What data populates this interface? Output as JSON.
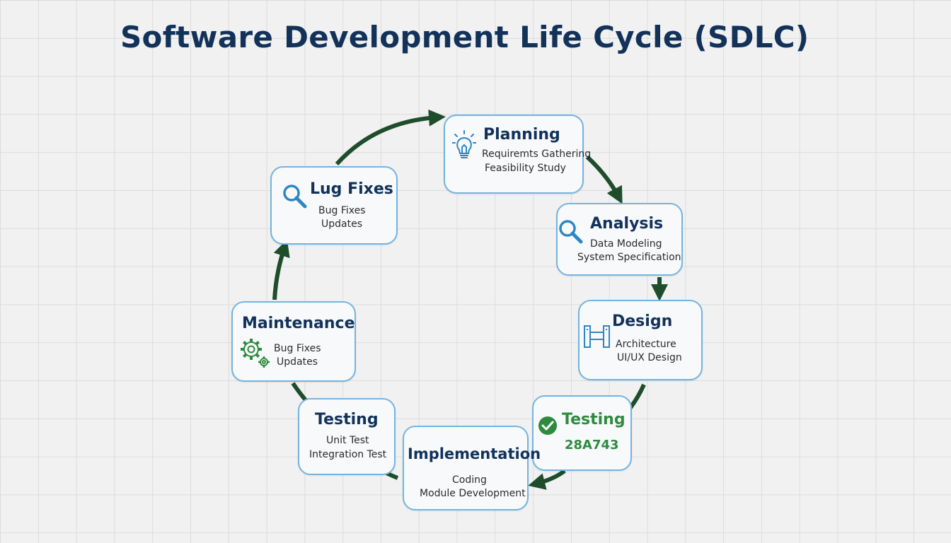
{
  "title": "Software Development Life Cycle (SDLC)",
  "colors": {
    "title": "#12325a",
    "node_border": "#74b4e0",
    "arrow": "#1e4d2b",
    "icon_blue": "#2f86c5",
    "icon_green": "#2e8b3e"
  },
  "nodes": {
    "planning": {
      "title": "Planning",
      "icon": "lightbulb-icon",
      "lines": [
        "Requiremts Gathering",
        "Feasibility Study"
      ]
    },
    "analysis": {
      "title": "Analysis",
      "icon": "magnifier-icon",
      "lines": [
        "Data Modeling",
        "System Specification"
      ]
    },
    "design": {
      "title": "Design",
      "icon": "blueprint-frame-icon",
      "lines": [
        "Architecture",
        "UI/UX Design"
      ]
    },
    "testing_right": {
      "title": "Testing",
      "icon": "check-circle-icon",
      "lines": [
        "28A743"
      ]
    },
    "implementation": {
      "title": "Implementation",
      "lines": [
        "Coding",
        "Module Development"
      ]
    },
    "testing_left": {
      "title": "Testing",
      "lines": [
        "Unit Test",
        "Integration Test"
      ]
    },
    "maintenance": {
      "title": "Maintenance",
      "icon": "gears-icon",
      "lines": [
        "Bug Fixes",
        "Updates"
      ]
    },
    "lug_fixes": {
      "title": "Lug Fixes",
      "icon": "magnifier-icon",
      "lines": [
        "Bug Fixes",
        "Updates"
      ]
    }
  }
}
